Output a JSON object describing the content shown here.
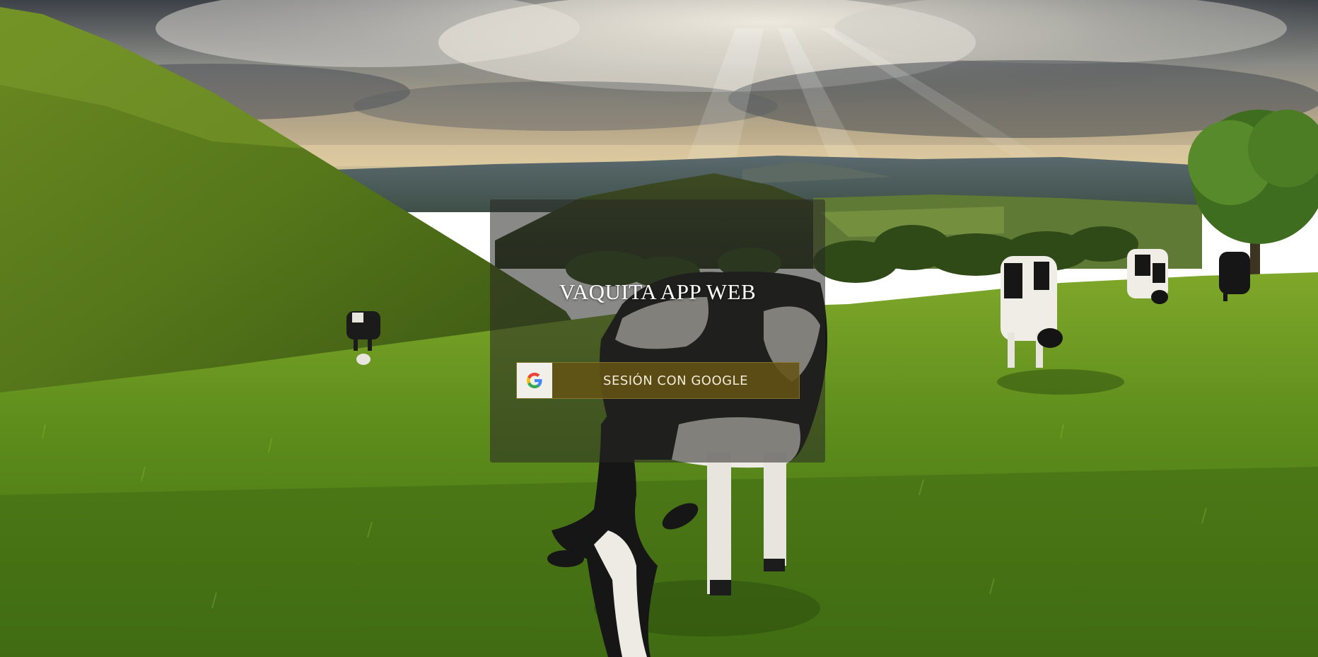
{
  "background": {
    "scene": "green-valley-with-grazing-cows"
  },
  "login": {
    "title": "VAQUITA APP WEB",
    "google_button_label": "SESIÓN CON GOOGLE",
    "google_icon": "google-g-icon"
  },
  "colors": {
    "panel_overlay": "#28281f",
    "button_background": "#645214",
    "button_text": "#f2ecd8",
    "title_text": "#ffffff"
  }
}
